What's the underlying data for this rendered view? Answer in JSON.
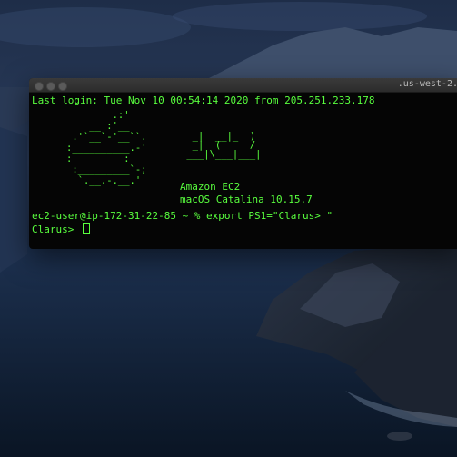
{
  "window": {
    "title": ".us-west-2.",
    "traffic_lights": [
      "close",
      "minimize",
      "maximize"
    ]
  },
  "terminal": {
    "text_color": "#59ff3e",
    "background": "#050505",
    "last_login": "Last login: Tue Nov 10 00:54:14 2020 from 205.251.233.178",
    "ascii_apple": "        .:'\n    __ :'__\n .'`__`-'__``.\n:__________.-'\n:_________:\n :_________`-;\n  `.__.-.__.'",
    "ascii_ec2": "  _|  __|_  )\n  _|  (     /\n ___|\\___|___|",
    "product_name": "Amazon EC2",
    "os_version": "macOS Catalina 10.15.7",
    "command_line": "ec2-user@ip-172-31-22-85 ~ % export PS1=\"Clarus> \"",
    "prompt": "Clarus> "
  },
  "desktop": {
    "wallpaper": "macOS Catalina island at dusk"
  }
}
